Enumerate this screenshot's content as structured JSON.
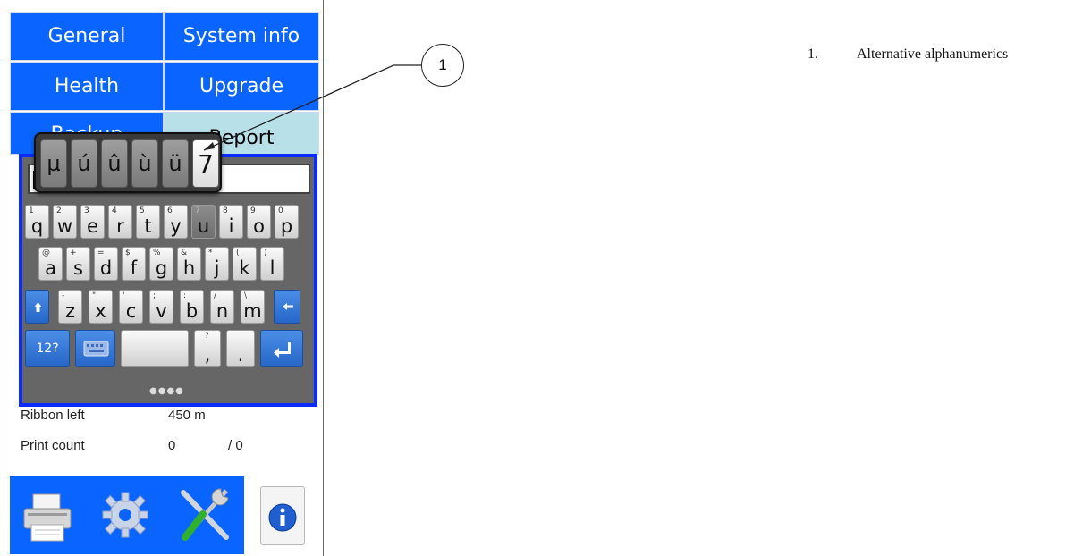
{
  "menu": {
    "general": "General",
    "system_info": "System info",
    "health": "Health",
    "upgrade": "Upgrade",
    "backup": "Backup",
    "report": "Report"
  },
  "keyboard": {
    "alternatives": [
      "µ",
      "ú",
      "û",
      "ù",
      "ü",
      "7"
    ],
    "row1": [
      {
        "pri": "q",
        "sec": "1"
      },
      {
        "pri": "w",
        "sec": "2"
      },
      {
        "pri": "e",
        "sec": "3"
      },
      {
        "pri": "r",
        "sec": "4"
      },
      {
        "pri": "t",
        "sec": "5"
      },
      {
        "pri": "y",
        "sec": "6"
      },
      {
        "pri": "u",
        "sec": "7"
      },
      {
        "pri": "i",
        "sec": "8"
      },
      {
        "pri": "o",
        "sec": "9"
      },
      {
        "pri": "p",
        "sec": "0"
      }
    ],
    "row2": [
      {
        "pri": "a",
        "sec": "@"
      },
      {
        "pri": "s",
        "sec": "+"
      },
      {
        "pri": "d",
        "sec": "="
      },
      {
        "pri": "f",
        "sec": "$"
      },
      {
        "pri": "g",
        "sec": "%"
      },
      {
        "pri": "h",
        "sec": "&"
      },
      {
        "pri": "j",
        "sec": "*"
      },
      {
        "pri": "k",
        "sec": "("
      },
      {
        "pri": "l",
        "sec": ")"
      }
    ],
    "row3": [
      {
        "pri": "z",
        "sec": "-"
      },
      {
        "pri": "x",
        "sec": "\""
      },
      {
        "pri": "c",
        "sec": "'"
      },
      {
        "pri": "v",
        "sec": ";"
      },
      {
        "pri": "b",
        "sec": ":"
      },
      {
        "pri": "n",
        "sec": "/"
      },
      {
        "pri": "m",
        "sec": "\\"
      }
    ],
    "numbers_label": "12?",
    "comma": {
      "pri": ",",
      "sec": "?"
    },
    "period": {
      "pri": ".",
      "sec": "!"
    },
    "page_dots": "●●●●"
  },
  "status": {
    "ribbon_left_label": "Ribbon left",
    "ribbon_left_value": "450 m",
    "print_count_label": "Print count",
    "print_count_value": "0",
    "print_count_total": "/ 0"
  },
  "callout": {
    "number": "1",
    "legend_number": "1.",
    "legend_text": "Alternative alphanumerics"
  },
  "colors": {
    "menu_blue": "#0a64ff",
    "menu_light": "#b7e0e8",
    "keyboard_frame": "#0a2cff",
    "keyboard_bg": "#666666"
  },
  "icons": [
    "printer-icon",
    "gear-icon",
    "tools-icon",
    "info-icon",
    "shift-icon",
    "backspace-icon",
    "keyboard-icon",
    "enter-icon"
  ]
}
